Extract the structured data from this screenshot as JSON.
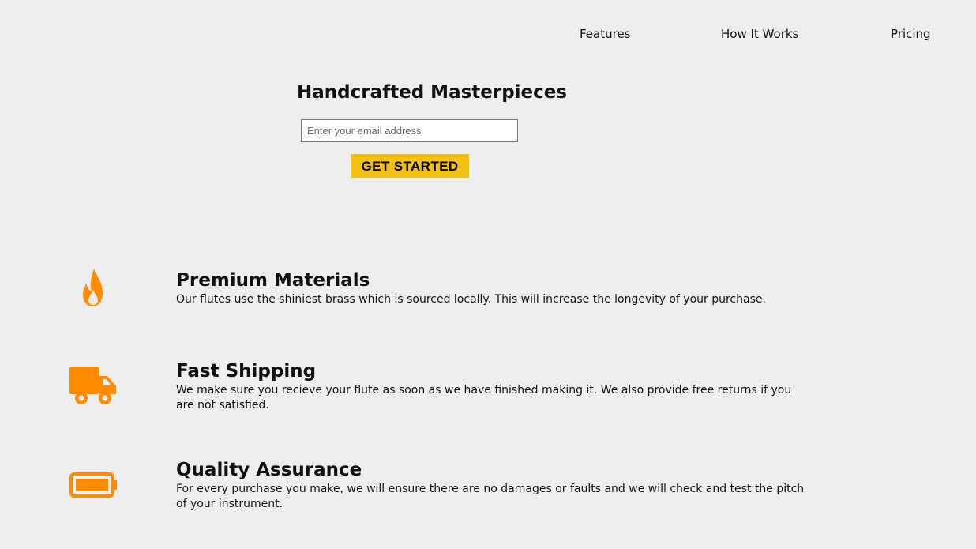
{
  "nav": {
    "items": [
      {
        "label": "Features"
      },
      {
        "label": "How It Works"
      },
      {
        "label": "Pricing"
      }
    ]
  },
  "hero": {
    "title": "Handcrafted Masterpieces",
    "email_placeholder": "Enter your email address",
    "email_value": "",
    "cta_label": "GET STARTED"
  },
  "features": [
    {
      "icon": "fire-icon",
      "title": "Premium Materials",
      "description": "Our flutes use the shiniest brass which is sourced locally. This will increase the longevity of your purchase."
    },
    {
      "icon": "truck-icon",
      "title": "Fast Shipping",
      "description": "We make sure you recieve your flute as soon as we have finished making it. We also provide free returns if you are not satisfied."
    },
    {
      "icon": "battery-full-icon",
      "title": "Quality Assurance",
      "description": "For every purchase you make, we will ensure there are no damages or faults and we will check and test the pitch of your instrument."
    }
  ],
  "colors": {
    "icon": "#ff8c00",
    "cta_background": "#f2c114",
    "page_background": "#eeeeee"
  }
}
